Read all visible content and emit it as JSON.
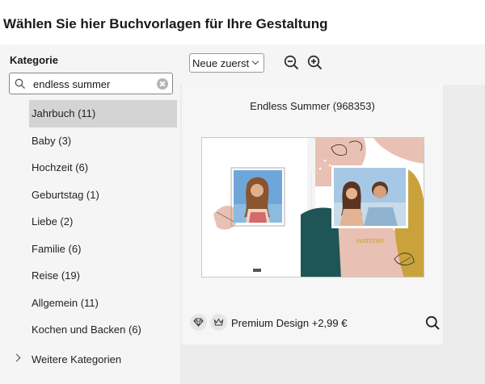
{
  "page": {
    "title": "Wählen Sie hier Buchvorlagen für Ihre Gestaltung"
  },
  "sidebar": {
    "heading": "Kategorie",
    "search_value": "endless summer",
    "categories": [
      {
        "label": "Jahrbuch (11)",
        "active": true
      },
      {
        "label": "Baby (3)"
      },
      {
        "label": "Hochzeit (6)"
      },
      {
        "label": "Geburtstag (1)"
      },
      {
        "label": "Liebe (2)"
      },
      {
        "label": "Familie (6)"
      },
      {
        "label": "Reise (19)"
      },
      {
        "label": "Allgemein (11)"
      },
      {
        "label": "Kochen und Backen (6)"
      }
    ],
    "more": "Weitere Kategorien"
  },
  "toolbar": {
    "sort_value": "Neue zuerst",
    "icons": [
      "zoom-out-icon",
      "zoom-in-icon"
    ]
  },
  "card": {
    "title": "Endless Summer (968353)",
    "premium_label": "Premium Design +2,99 €",
    "icons": [
      "diamond-icon",
      "crown-icon",
      "magnifier-icon"
    ],
    "cover_text": "summer"
  },
  "colors": {
    "sidebar_bg": "#f5f5f5",
    "content_bg": "#ececec",
    "active_item": "#d4d4d4",
    "teal": "#1f5557",
    "mustard": "#c9a23c",
    "blush": "#e9c1b4"
  }
}
